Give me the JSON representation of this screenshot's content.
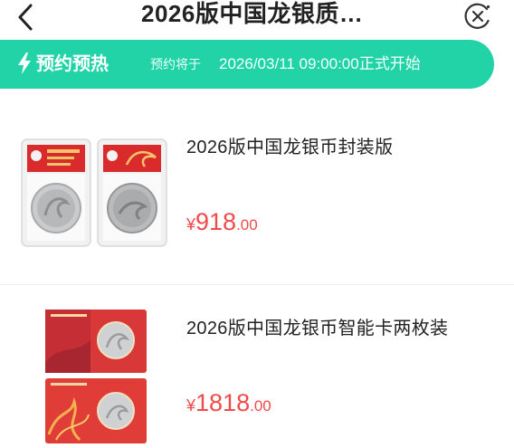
{
  "nav": {
    "title": "2026版中国龙银质…",
    "back_icon": "chevron-left-icon",
    "close_icon": "close-circle-icon"
  },
  "banner": {
    "icon": "lightning-icon",
    "title": "预约预热",
    "prefix": "预约将于",
    "time": "2026/03/11 09:00:00正式开始",
    "color": "#22d3a8"
  },
  "products": [
    {
      "name": "2026版中国龙银币封装版",
      "price": {
        "symbol": "¥",
        "integer": "918",
        "decimal": ".00"
      },
      "image": "coin-slab-pair"
    },
    {
      "name": "2026版中国龙银币智能卡两枚装",
      "price": {
        "symbol": "¥",
        "integer": "1818",
        "decimal": ".00"
      },
      "image": "coin-card-pair"
    }
  ],
  "colors": {
    "price": "#f04a4a",
    "accent": "#22d3a8"
  }
}
